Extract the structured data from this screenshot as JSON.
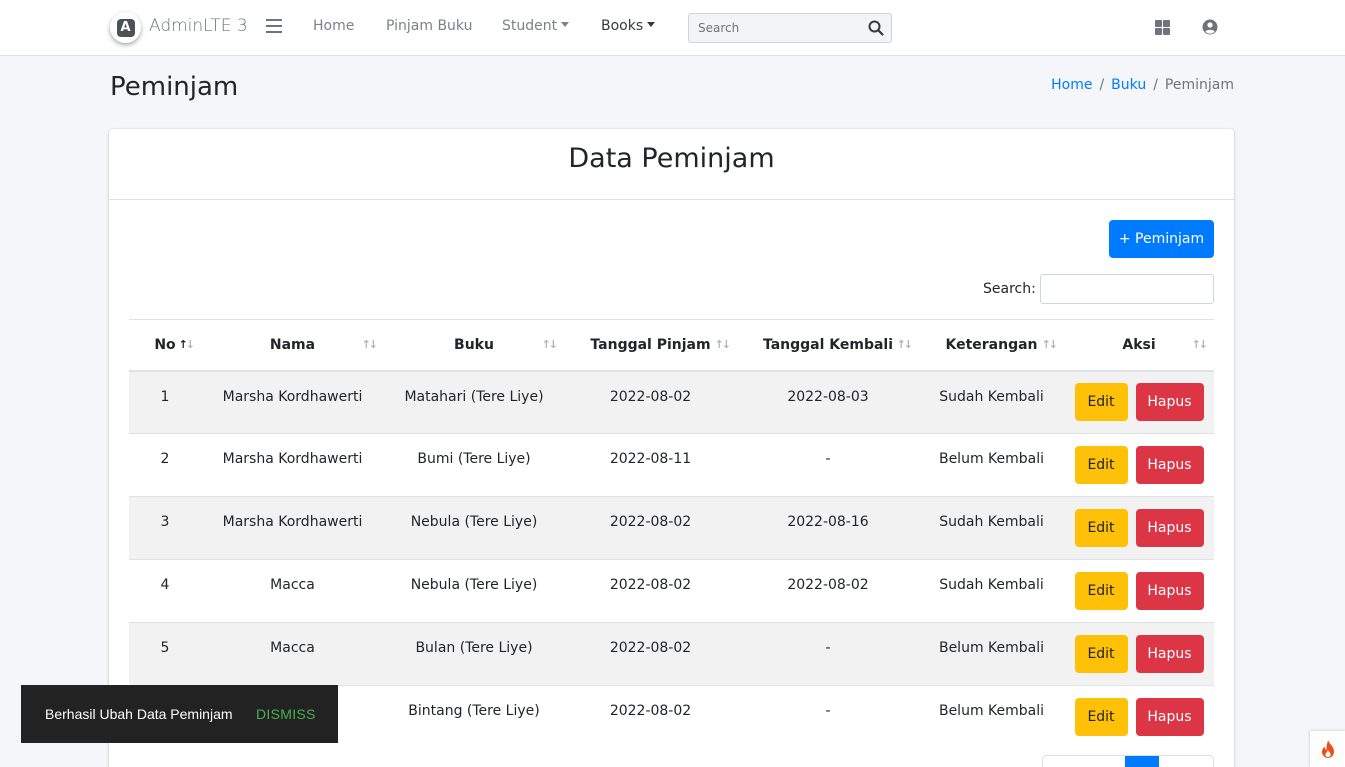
{
  "brand": {
    "name": "AdminLTE 3",
    "logo_letter": "A"
  },
  "navbar": {
    "links": [
      {
        "label": "Home"
      },
      {
        "label": "Pinjam Buku"
      },
      {
        "label": "Student"
      },
      {
        "label": "Books"
      }
    ],
    "search_placeholder": "Search",
    "icons": [
      "menu-icon",
      "search-icon",
      "apps-grid-icon",
      "user-circle-icon"
    ]
  },
  "content_header": {
    "title": "Peminjam",
    "breadcrumb": [
      "Home",
      "Buku",
      "Peminjam"
    ]
  },
  "card": {
    "title": "Data Peminjam",
    "add_button": "+ Peminjam",
    "search_label": "Search:",
    "table": {
      "headers": [
        "No",
        "Nama",
        "Buku",
        "Tanggal Pinjam",
        "Tanggal Kembali",
        "Keterangan",
        "Aksi"
      ],
      "rows": [
        {
          "no": "1",
          "nama": "Marsha Kordhawerti",
          "buku": "Matahari (Tere Liye)",
          "pinjam": "2022-08-02",
          "kembali": "2022-08-03",
          "keterangan": "Sudah Kembali"
        },
        {
          "no": "2",
          "nama": "Marsha Kordhawerti",
          "buku": "Bumi (Tere Liye)",
          "pinjam": "2022-08-11",
          "kembali": "-",
          "keterangan": "Belum Kembali"
        },
        {
          "no": "3",
          "nama": "Marsha Kordhawerti",
          "buku": "Nebula (Tere Liye)",
          "pinjam": "2022-08-02",
          "kembali": "2022-08-16",
          "keterangan": "Sudah Kembali"
        },
        {
          "no": "4",
          "nama": "Macca",
          "buku": "Nebula (Tere Liye)",
          "pinjam": "2022-08-02",
          "kembali": "2022-08-02",
          "keterangan": "Sudah Kembali"
        },
        {
          "no": "5",
          "nama": "Macca",
          "buku": "Bulan (Tere Liye)",
          "pinjam": "2022-08-02",
          "kembali": "-",
          "keterangan": "Belum Kembali"
        },
        {
          "no": "",
          "nama": "",
          "buku": "Bintang (Tere Liye)",
          "pinjam": "2022-08-02",
          "kembali": "-",
          "keterangan": "Belum Kembali"
        }
      ],
      "edit_label": "Edit",
      "delete_label": "Hapus"
    }
  },
  "toast": {
    "message": "Berhasil Ubah Data Peminjam",
    "action": "DISMISS"
  },
  "colors": {
    "primary": "#007bff",
    "warning": "#ffc107",
    "danger": "#dc3545",
    "toast_action": "#4caf50"
  }
}
